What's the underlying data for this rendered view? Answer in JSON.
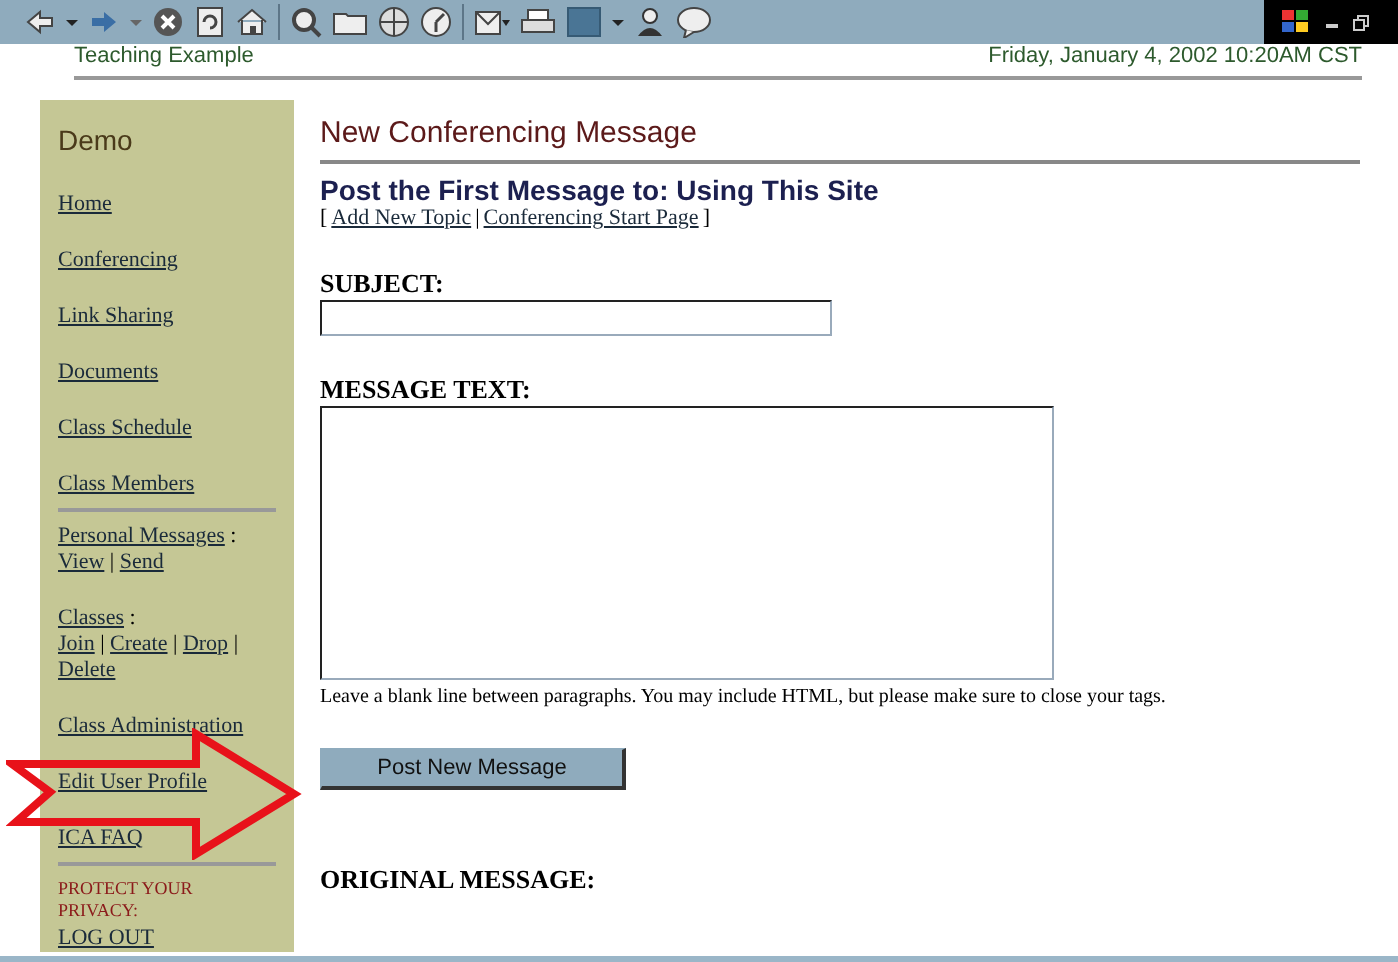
{
  "header": {
    "site": "Teaching Example",
    "datetime": "Friday, January 4, 2002 10:20AM CST"
  },
  "sidebar": {
    "title": "Demo",
    "items": [
      {
        "kind": "link",
        "label": "Home"
      },
      {
        "kind": "link",
        "label": "Conferencing"
      },
      {
        "kind": "link",
        "label": "Link Sharing"
      },
      {
        "kind": "link",
        "label": "Documents"
      },
      {
        "kind": "link",
        "label": "Class Schedule"
      },
      {
        "kind": "link",
        "label": "Class Members"
      },
      {
        "kind": "separator"
      },
      {
        "kind": "group",
        "label": "Personal Messages",
        "label_suffix": ":",
        "separator": "|",
        "links": [
          "View",
          "Send"
        ]
      },
      {
        "kind": "group",
        "label": "Classes",
        "label_suffix": ":",
        "separator": "|",
        "links": [
          "Join",
          "Create",
          "Drop",
          "Delete"
        ]
      },
      {
        "kind": "link",
        "label": "Class Administration"
      },
      {
        "kind": "link",
        "label": "Edit User Profile"
      },
      {
        "kind": "link",
        "label": "ICA FAQ"
      },
      {
        "kind": "separator"
      },
      {
        "kind": "notice",
        "text": "PROTECT YOUR PRIVACY:"
      },
      {
        "kind": "link",
        "label": "LOG OUT"
      }
    ]
  },
  "main": {
    "title": "New Conferencing Message",
    "subtitle": "Post the First Message to: Using This Site",
    "links_prefix": "[",
    "links_separator": "|",
    "links_suffix": "]",
    "links": [
      "Add New Topic",
      "Conferencing Start Page"
    ],
    "subject": {
      "label": "SUBJECT:"
    },
    "message": {
      "label": "MESSAGE TEXT:"
    },
    "hint": "Leave a blank line between paragraphs. You may include HTML, but please make sure to close your tags.",
    "button": "Post New Message",
    "original_heading": "ORIGINAL MESSAGE:"
  }
}
